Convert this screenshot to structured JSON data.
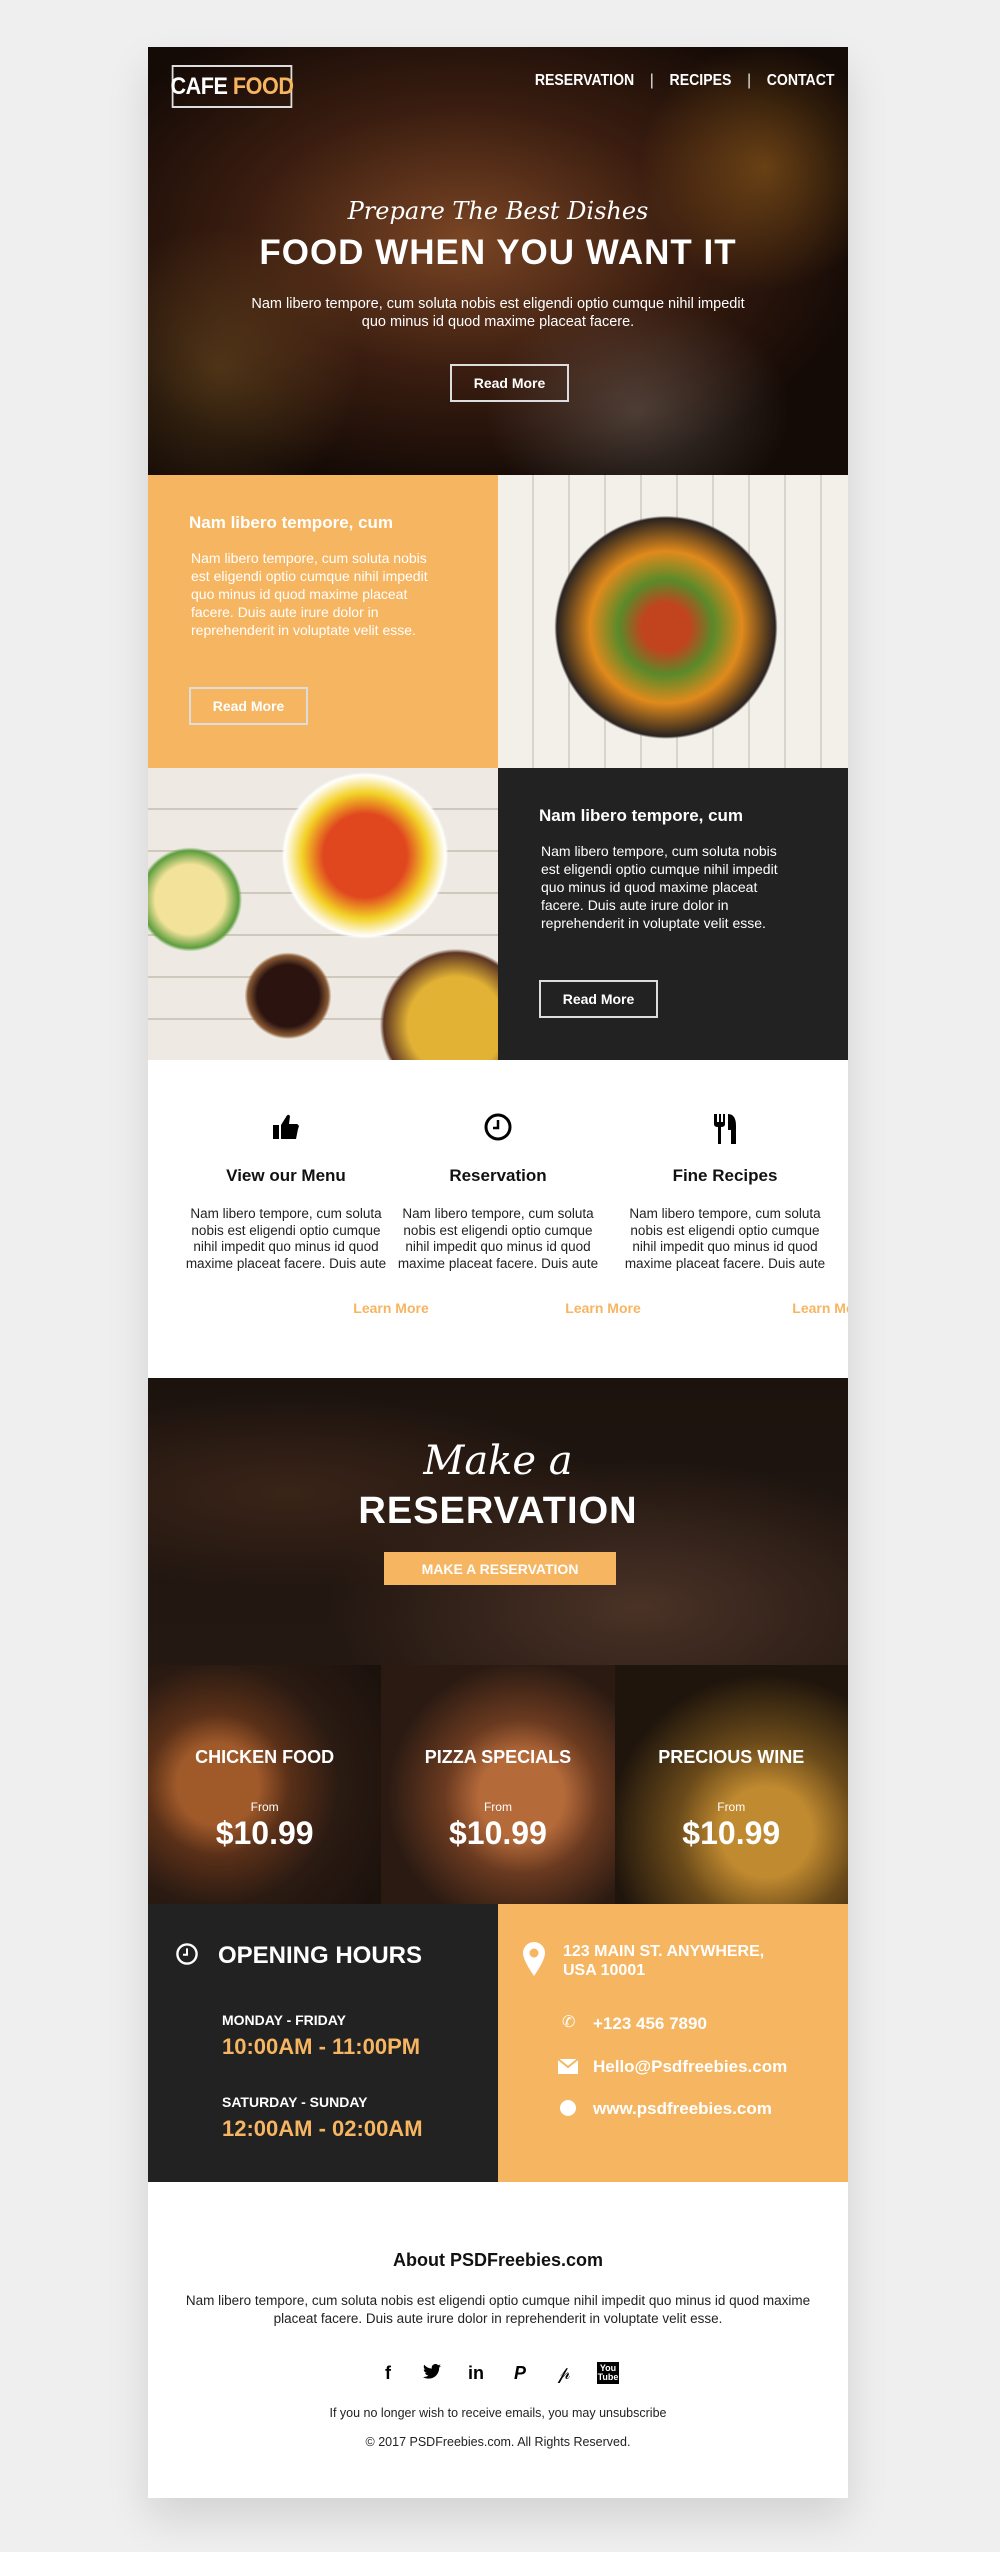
{
  "header": {
    "logo_part1": "CAFE",
    "logo_part2": "FOOD",
    "nav": [
      "RESERVATION",
      "RECIPES",
      "CONTACT"
    ],
    "nav_separator": "|"
  },
  "hero": {
    "script": "Prepare The Best Dishes",
    "title": "FOOD WHEN YOU WANT IT",
    "text": "Nam libero tempore, cum soluta nobis est eligendi optio cumque nihil impedit quo minus id quod maxime placeat facere.",
    "button": "Read More"
  },
  "blocks": [
    {
      "title": "Nam libero tempore, cum",
      "text": "Nam libero tempore, cum soluta nobis est eligendi optio cumque nihil impedit quo minus id quod maxime placeat facere. Duis aute irure dolor in reprehenderit in voluptate velit esse.",
      "button": "Read More"
    },
    {
      "title": "Nam libero tempore, cum",
      "text": "Nam libero tempore, cum soluta nobis est eligendi optio cumque nihil impedit quo minus id quod maxime placeat facere. Duis aute irure dolor in reprehenderit in voluptate velit esse.",
      "button": "Read More"
    }
  ],
  "features": [
    {
      "icon": "thumbs-up-icon",
      "title": "View our Menu",
      "text": "Nam libero tempore, cum soluta nobis est eligendi optio cumque nihil impedit quo minus id quod maxime placeat facere. Duis aute",
      "link": "Learn More"
    },
    {
      "icon": "clock-icon",
      "title": "Reservation",
      "text": "Nam libero tempore, cum soluta nobis est eligendi optio cumque nihil impedit quo minus id quod maxime placeat facere. Duis aute",
      "link": "Learn More"
    },
    {
      "icon": "fork-knife-icon",
      "title": "Fine Recipes",
      "text": "Nam libero tempore, cum soluta nobis est eligendi optio cumque nihil impedit quo minus id quod maxime placeat facere. Duis aute",
      "link": "Learn More"
    }
  ],
  "reservation": {
    "script": "Make a",
    "title": "RESERVATION",
    "button": "MAKE A RESERVATION"
  },
  "cards": [
    {
      "title": "CHICKEN FOOD",
      "from": "From",
      "price": "$10.99"
    },
    {
      "title": "PIZZA SPECIALS",
      "from": "From",
      "price": "$10.99"
    },
    {
      "title": "PRECIOUS WINE",
      "from": "From",
      "price": "$10.99"
    }
  ],
  "hours": {
    "title": "OPENING HOURS",
    "weekday_label": "MONDAY - FRIDAY",
    "weekday_time": "10:00AM - 11:00PM",
    "weekend_label": "SATURDAY - SUNDAY",
    "weekend_time": "12:00AM - 02:00AM"
  },
  "contact": {
    "address_line1": "123 MAIN ST. ANYWHERE,",
    "address_line2": "USA 10001",
    "phone": "+123 456 7890",
    "email": "Hello@Psdfreebies.com",
    "website": "www.psdfreebies.com"
  },
  "footer": {
    "title": "About PSDFreebies.com",
    "text": "Nam libero tempore, cum soluta nobis est eligendi optio cumque nihil impedit quo minus id quod maxime placeat facere. Duis aute irure dolor in reprehenderit in voluptate velit esse.",
    "social": [
      "facebook-icon",
      "twitter-icon",
      "linkedin-icon",
      "paypal-icon",
      "pinterest-icon",
      "youtube-icon"
    ],
    "unsubscribe": "If you no longer wish to receive emails, you may unsubscribe",
    "copyright": "© 2017 PSDFreebies.com. All Rights Reserved."
  },
  "colors": {
    "accent": "#f6b561",
    "dark": "#222222"
  }
}
